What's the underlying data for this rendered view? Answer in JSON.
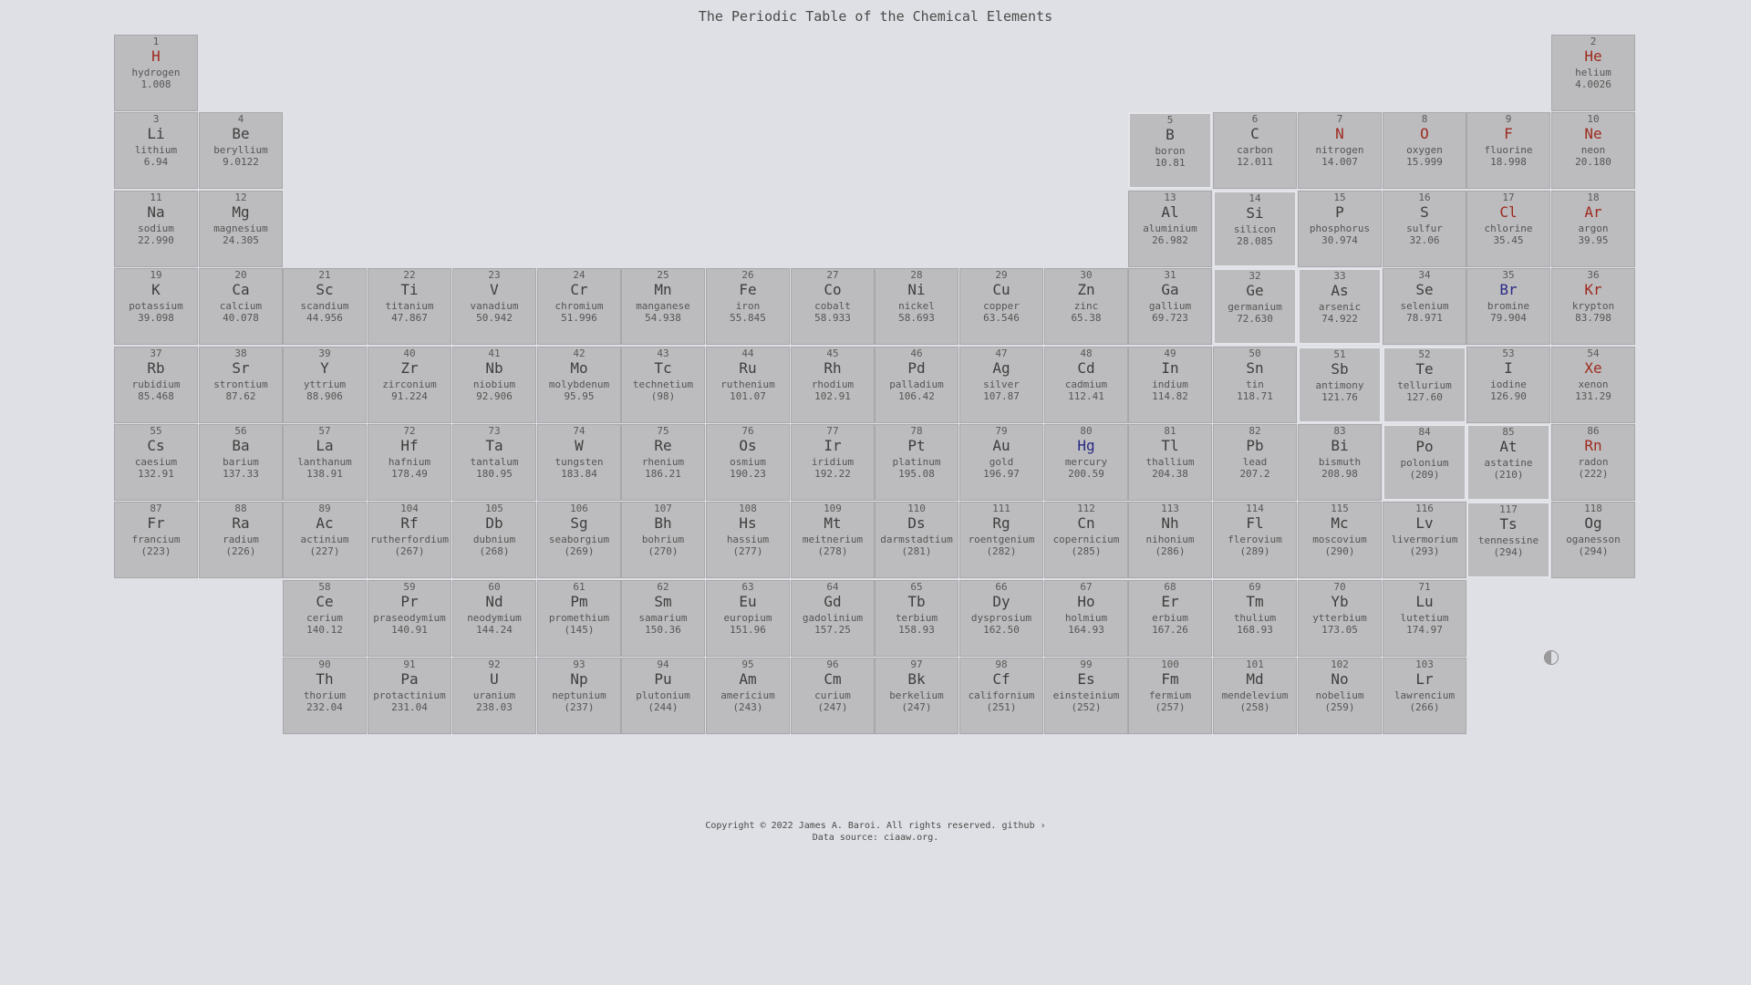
{
  "title": "The Periodic Table of the Chemical Elements",
  "colors": {
    "background": "#dfe0e5",
    "cell": "#bcbcbe",
    "gas_symbol": "#9e2a1e",
    "liquid_symbol": "#2a2a86",
    "metalloid_border": "#e4e5ea"
  },
  "toggle_icon": "theme-toggle-icon",
  "elements": [
    {
      "n": "1",
      "s": "H",
      "name": "hydrogen",
      "w": "1.008",
      "col": 1,
      "row": 1,
      "state": "gas"
    },
    {
      "n": "2",
      "s": "He",
      "name": "helium",
      "w": "4.0026",
      "col": 18,
      "row": 1,
      "state": "gas"
    },
    {
      "n": "3",
      "s": "Li",
      "name": "lithium",
      "w": "6.94",
      "col": 1,
      "row": 2
    },
    {
      "n": "4",
      "s": "Be",
      "name": "beryllium",
      "w": "9.0122",
      "col": 2,
      "row": 2
    },
    {
      "n": "5",
      "s": "B",
      "name": "boron",
      "w": "10.81",
      "col": 13,
      "row": 2,
      "metalloid": true
    },
    {
      "n": "6",
      "s": "C",
      "name": "carbon",
      "w": "12.011",
      "col": 14,
      "row": 2
    },
    {
      "n": "7",
      "s": "N",
      "name": "nitrogen",
      "w": "14.007",
      "col": 15,
      "row": 2,
      "state": "gas"
    },
    {
      "n": "8",
      "s": "O",
      "name": "oxygen",
      "w": "15.999",
      "col": 16,
      "row": 2,
      "state": "gas"
    },
    {
      "n": "9",
      "s": "F",
      "name": "fluorine",
      "w": "18.998",
      "col": 17,
      "row": 2,
      "state": "gas"
    },
    {
      "n": "10",
      "s": "Ne",
      "name": "neon",
      "w": "20.180",
      "col": 18,
      "row": 2,
      "state": "gas"
    },
    {
      "n": "11",
      "s": "Na",
      "name": "sodium",
      "w": "22.990",
      "col": 1,
      "row": 3
    },
    {
      "n": "12",
      "s": "Mg",
      "name": "magnesium",
      "w": "24.305",
      "col": 2,
      "row": 3
    },
    {
      "n": "13",
      "s": "Al",
      "name": "aluminium",
      "w": "26.982",
      "col": 13,
      "row": 3
    },
    {
      "n": "14",
      "s": "Si",
      "name": "silicon",
      "w": "28.085",
      "col": 14,
      "row": 3,
      "metalloid": true
    },
    {
      "n": "15",
      "s": "P",
      "name": "phosphorus",
      "w": "30.974",
      "col": 15,
      "row": 3
    },
    {
      "n": "16",
      "s": "S",
      "name": "sulfur",
      "w": "32.06",
      "col": 16,
      "row": 3
    },
    {
      "n": "17",
      "s": "Cl",
      "name": "chlorine",
      "w": "35.45",
      "col": 17,
      "row": 3,
      "state": "gas"
    },
    {
      "n": "18",
      "s": "Ar",
      "name": "argon",
      "w": "39.95",
      "col": 18,
      "row": 3,
      "state": "gas"
    },
    {
      "n": "19",
      "s": "K",
      "name": "potassium",
      "w": "39.098",
      "col": 1,
      "row": 4
    },
    {
      "n": "20",
      "s": "Ca",
      "name": "calcium",
      "w": "40.078",
      "col": 2,
      "row": 4
    },
    {
      "n": "21",
      "s": "Sc",
      "name": "scandium",
      "w": "44.956",
      "col": 3,
      "row": 4
    },
    {
      "n": "22",
      "s": "Ti",
      "name": "titanium",
      "w": "47.867",
      "col": 4,
      "row": 4
    },
    {
      "n": "23",
      "s": "V",
      "name": "vanadium",
      "w": "50.942",
      "col": 5,
      "row": 4
    },
    {
      "n": "24",
      "s": "Cr",
      "name": "chromium",
      "w": "51.996",
      "col": 6,
      "row": 4
    },
    {
      "n": "25",
      "s": "Mn",
      "name": "manganese",
      "w": "54.938",
      "col": 7,
      "row": 4
    },
    {
      "n": "26",
      "s": "Fe",
      "name": "iron",
      "w": "55.845",
      "col": 8,
      "row": 4
    },
    {
      "n": "27",
      "s": "Co",
      "name": "cobalt",
      "w": "58.933",
      "col": 9,
      "row": 4
    },
    {
      "n": "28",
      "s": "Ni",
      "name": "nickel",
      "w": "58.693",
      "col": 10,
      "row": 4
    },
    {
      "n": "29",
      "s": "Cu",
      "name": "copper",
      "w": "63.546",
      "col": 11,
      "row": 4
    },
    {
      "n": "30",
      "s": "Zn",
      "name": "zinc",
      "w": "65.38",
      "col": 12,
      "row": 4
    },
    {
      "n": "31",
      "s": "Ga",
      "name": "gallium",
      "w": "69.723",
      "col": 13,
      "row": 4
    },
    {
      "n": "32",
      "s": "Ge",
      "name": "germanium",
      "w": "72.630",
      "col": 14,
      "row": 4,
      "metalloid": true
    },
    {
      "n": "33",
      "s": "As",
      "name": "arsenic",
      "w": "74.922",
      "col": 15,
      "row": 4,
      "metalloid": true
    },
    {
      "n": "34",
      "s": "Se",
      "name": "selenium",
      "w": "78.971",
      "col": 16,
      "row": 4
    },
    {
      "n": "35",
      "s": "Br",
      "name": "bromine",
      "w": "79.904",
      "col": 17,
      "row": 4,
      "state": "liquid"
    },
    {
      "n": "36",
      "s": "Kr",
      "name": "krypton",
      "w": "83.798",
      "col": 18,
      "row": 4,
      "state": "gas"
    },
    {
      "n": "37",
      "s": "Rb",
      "name": "rubidium",
      "w": "85.468",
      "col": 1,
      "row": 5
    },
    {
      "n": "38",
      "s": "Sr",
      "name": "strontium",
      "w": "87.62",
      "col": 2,
      "row": 5
    },
    {
      "n": "39",
      "s": "Y",
      "name": "yttrium",
      "w": "88.906",
      "col": 3,
      "row": 5
    },
    {
      "n": "40",
      "s": "Zr",
      "name": "zirconium",
      "w": "91.224",
      "col": 4,
      "row": 5
    },
    {
      "n": "41",
      "s": "Nb",
      "name": "niobium",
      "w": "92.906",
      "col": 5,
      "row": 5
    },
    {
      "n": "42",
      "s": "Mo",
      "name": "molybdenum",
      "w": "95.95",
      "col": 6,
      "row": 5
    },
    {
      "n": "43",
      "s": "Tc",
      "name": "technetium",
      "w": "(98)",
      "col": 7,
      "row": 5
    },
    {
      "n": "44",
      "s": "Ru",
      "name": "ruthenium",
      "w": "101.07",
      "col": 8,
      "row": 5
    },
    {
      "n": "45",
      "s": "Rh",
      "name": "rhodium",
      "w": "102.91",
      "col": 9,
      "row": 5
    },
    {
      "n": "46",
      "s": "Pd",
      "name": "palladium",
      "w": "106.42",
      "col": 10,
      "row": 5
    },
    {
      "n": "47",
      "s": "Ag",
      "name": "silver",
      "w": "107.87",
      "col": 11,
      "row": 5
    },
    {
      "n": "48",
      "s": "Cd",
      "name": "cadmium",
      "w": "112.41",
      "col": 12,
      "row": 5
    },
    {
      "n": "49",
      "s": "In",
      "name": "indium",
      "w": "114.82",
      "col": 13,
      "row": 5
    },
    {
      "n": "50",
      "s": "Sn",
      "name": "tin",
      "w": "118.71",
      "col": 14,
      "row": 5
    },
    {
      "n": "51",
      "s": "Sb",
      "name": "antimony",
      "w": "121.76",
      "col": 15,
      "row": 5,
      "metalloid": true
    },
    {
      "n": "52",
      "s": "Te",
      "name": "tellurium",
      "w": "127.60",
      "col": 16,
      "row": 5,
      "metalloid": true
    },
    {
      "n": "53",
      "s": "I",
      "name": "iodine",
      "w": "126.90",
      "col": 17,
      "row": 5
    },
    {
      "n": "54",
      "s": "Xe",
      "name": "xenon",
      "w": "131.29",
      "col": 18,
      "row": 5,
      "state": "gas"
    },
    {
      "n": "55",
      "s": "Cs",
      "name": "caesium",
      "w": "132.91",
      "col": 1,
      "row": 6
    },
    {
      "n": "56",
      "s": "Ba",
      "name": "barium",
      "w": "137.33",
      "col": 2,
      "row": 6
    },
    {
      "n": "57",
      "s": "La",
      "name": "lanthanum",
      "w": "138.91",
      "col": 3,
      "row": 6
    },
    {
      "n": "72",
      "s": "Hf",
      "name": "hafnium",
      "w": "178.49",
      "col": 4,
      "row": 6
    },
    {
      "n": "73",
      "s": "Ta",
      "name": "tantalum",
      "w": "180.95",
      "col": 5,
      "row": 6
    },
    {
      "n": "74",
      "s": "W",
      "name": "tungsten",
      "w": "183.84",
      "col": 6,
      "row": 6
    },
    {
      "n": "75",
      "s": "Re",
      "name": "rhenium",
      "w": "186.21",
      "col": 7,
      "row": 6
    },
    {
      "n": "76",
      "s": "Os",
      "name": "osmium",
      "w": "190.23",
      "col": 8,
      "row": 6
    },
    {
      "n": "77",
      "s": "Ir",
      "name": "iridium",
      "w": "192.22",
      "col": 9,
      "row": 6
    },
    {
      "n": "78",
      "s": "Pt",
      "name": "platinum",
      "w": "195.08",
      "col": 10,
      "row": 6
    },
    {
      "n": "79",
      "s": "Au",
      "name": "gold",
      "w": "196.97",
      "col": 11,
      "row": 6
    },
    {
      "n": "80",
      "s": "Hg",
      "name": "mercury",
      "w": "200.59",
      "col": 12,
      "row": 6,
      "state": "liquid"
    },
    {
      "n": "81",
      "s": "Tl",
      "name": "thallium",
      "w": "204.38",
      "col": 13,
      "row": 6
    },
    {
      "n": "82",
      "s": "Pb",
      "name": "lead",
      "w": "207.2",
      "col": 14,
      "row": 6
    },
    {
      "n": "83",
      "s": "Bi",
      "name": "bismuth",
      "w": "208.98",
      "col": 15,
      "row": 6
    },
    {
      "n": "84",
      "s": "Po",
      "name": "polonium",
      "w": "(209)",
      "col": 16,
      "row": 6,
      "metalloid": true
    },
    {
      "n": "85",
      "s": "At",
      "name": "astatine",
      "w": "(210)",
      "col": 17,
      "row": 6,
      "metalloid": true
    },
    {
      "n": "86",
      "s": "Rn",
      "name": "radon",
      "w": "(222)",
      "col": 18,
      "row": 6,
      "state": "gas"
    },
    {
      "n": "87",
      "s": "Fr",
      "name": "francium",
      "w": "(223)",
      "col": 1,
      "row": 7
    },
    {
      "n": "88",
      "s": "Ra",
      "name": "radium",
      "w": "(226)",
      "col": 2,
      "row": 7
    },
    {
      "n": "89",
      "s": "Ac",
      "name": "actinium",
      "w": "(227)",
      "col": 3,
      "row": 7
    },
    {
      "n": "104",
      "s": "Rf",
      "name": "rutherfordium",
      "w": "(267)",
      "col": 4,
      "row": 7
    },
    {
      "n": "105",
      "s": "Db",
      "name": "dubnium",
      "w": "(268)",
      "col": 5,
      "row": 7
    },
    {
      "n": "106",
      "s": "Sg",
      "name": "seaborgium",
      "w": "(269)",
      "col": 6,
      "row": 7
    },
    {
      "n": "107",
      "s": "Bh",
      "name": "bohrium",
      "w": "(270)",
      "col": 7,
      "row": 7
    },
    {
      "n": "108",
      "s": "Hs",
      "name": "hassium",
      "w": "(277)",
      "col": 8,
      "row": 7
    },
    {
      "n": "109",
      "s": "Mt",
      "name": "meitnerium",
      "w": "(278)",
      "col": 9,
      "row": 7
    },
    {
      "n": "110",
      "s": "Ds",
      "name": "darmstadtium",
      "w": "(281)",
      "col": 10,
      "row": 7
    },
    {
      "n": "111",
      "s": "Rg",
      "name": "roentgenium",
      "w": "(282)",
      "col": 11,
      "row": 7
    },
    {
      "n": "112",
      "s": "Cn",
      "name": "copernicium",
      "w": "(285)",
      "col": 12,
      "row": 7
    },
    {
      "n": "113",
      "s": "Nh",
      "name": "nihonium",
      "w": "(286)",
      "col": 13,
      "row": 7
    },
    {
      "n": "114",
      "s": "Fl",
      "name": "flerovium",
      "w": "(289)",
      "col": 14,
      "row": 7
    },
    {
      "n": "115",
      "s": "Mc",
      "name": "moscovium",
      "w": "(290)",
      "col": 15,
      "row": 7
    },
    {
      "n": "116",
      "s": "Lv",
      "name": "livermorium",
      "w": "(293)",
      "col": 16,
      "row": 7
    },
    {
      "n": "117",
      "s": "Ts",
      "name": "tennessine",
      "w": "(294)",
      "col": 17,
      "row": 7,
      "metalloid": true
    },
    {
      "n": "118",
      "s": "Og",
      "name": "oganesson",
      "w": "(294)",
      "col": 18,
      "row": 7
    },
    {
      "n": "58",
      "s": "Ce",
      "name": "cerium",
      "w": "140.12",
      "col": 3,
      "row": 8
    },
    {
      "n": "59",
      "s": "Pr",
      "name": "praseodymium",
      "w": "140.91",
      "col": 4,
      "row": 8
    },
    {
      "n": "60",
      "s": "Nd",
      "name": "neodymium",
      "w": "144.24",
      "col": 5,
      "row": 8
    },
    {
      "n": "61",
      "s": "Pm",
      "name": "promethium",
      "w": "(145)",
      "col": 6,
      "row": 8
    },
    {
      "n": "62",
      "s": "Sm",
      "name": "samarium",
      "w": "150.36",
      "col": 7,
      "row": 8
    },
    {
      "n": "63",
      "s": "Eu",
      "name": "europium",
      "w": "151.96",
      "col": 8,
      "row": 8
    },
    {
      "n": "64",
      "s": "Gd",
      "name": "gadolinium",
      "w": "157.25",
      "col": 9,
      "row": 8
    },
    {
      "n": "65",
      "s": "Tb",
      "name": "terbium",
      "w": "158.93",
      "col": 10,
      "row": 8
    },
    {
      "n": "66",
      "s": "Dy",
      "name": "dysprosium",
      "w": "162.50",
      "col": 11,
      "row": 8
    },
    {
      "n": "67",
      "s": "Ho",
      "name": "holmium",
      "w": "164.93",
      "col": 12,
      "row": 8
    },
    {
      "n": "68",
      "s": "Er",
      "name": "erbium",
      "w": "167.26",
      "col": 13,
      "row": 8
    },
    {
      "n": "69",
      "s": "Tm",
      "name": "thulium",
      "w": "168.93",
      "col": 14,
      "row": 8
    },
    {
      "n": "70",
      "s": "Yb",
      "name": "ytterbium",
      "w": "173.05",
      "col": 15,
      "row": 8
    },
    {
      "n": "71",
      "s": "Lu",
      "name": "lutetium",
      "w": "174.97",
      "col": 16,
      "row": 8
    },
    {
      "n": "90",
      "s": "Th",
      "name": "thorium",
      "w": "232.04",
      "col": 3,
      "row": 9
    },
    {
      "n": "91",
      "s": "Pa",
      "name": "protactinium",
      "w": "231.04",
      "col": 4,
      "row": 9
    },
    {
      "n": "92",
      "s": "U",
      "name": "uranium",
      "w": "238.03",
      "col": 5,
      "row": 9
    },
    {
      "n": "93",
      "s": "Np",
      "name": "neptunium",
      "w": "(237)",
      "col": 6,
      "row": 9
    },
    {
      "n": "94",
      "s": "Pu",
      "name": "plutonium",
      "w": "(244)",
      "col": 7,
      "row": 9
    },
    {
      "n": "95",
      "s": "Am",
      "name": "americium",
      "w": "(243)",
      "col": 8,
      "row": 9
    },
    {
      "n": "96",
      "s": "Cm",
      "name": "curium",
      "w": "(247)",
      "col": 9,
      "row": 9
    },
    {
      "n": "97",
      "s": "Bk",
      "name": "berkelium",
      "w": "(247)",
      "col": 10,
      "row": 9
    },
    {
      "n": "98",
      "s": "Cf",
      "name": "californium",
      "w": "(251)",
      "col": 11,
      "row": 9
    },
    {
      "n": "99",
      "s": "Es",
      "name": "einsteinium",
      "w": "(252)",
      "col": 12,
      "row": 9
    },
    {
      "n": "100",
      "s": "Fm",
      "name": "fermium",
      "w": "(257)",
      "col": 13,
      "row": 9
    },
    {
      "n": "101",
      "s": "Md",
      "name": "mendelevium",
      "w": "(258)",
      "col": 14,
      "row": 9
    },
    {
      "n": "102",
      "s": "No",
      "name": "nobelium",
      "w": "(259)",
      "col": 15,
      "row": 9
    },
    {
      "n": "103",
      "s": "Lr",
      "name": "lawrencium",
      "w": "(266)",
      "col": 16,
      "row": 9
    }
  ],
  "footer": {
    "copyright": "Copyright © 2022 James A. Baroi. All rights reserved. ",
    "github_link": "github ›",
    "data_source_prefix": "Data source: ",
    "data_source_link": "ciaaw.org",
    "data_source_suffix": "."
  }
}
